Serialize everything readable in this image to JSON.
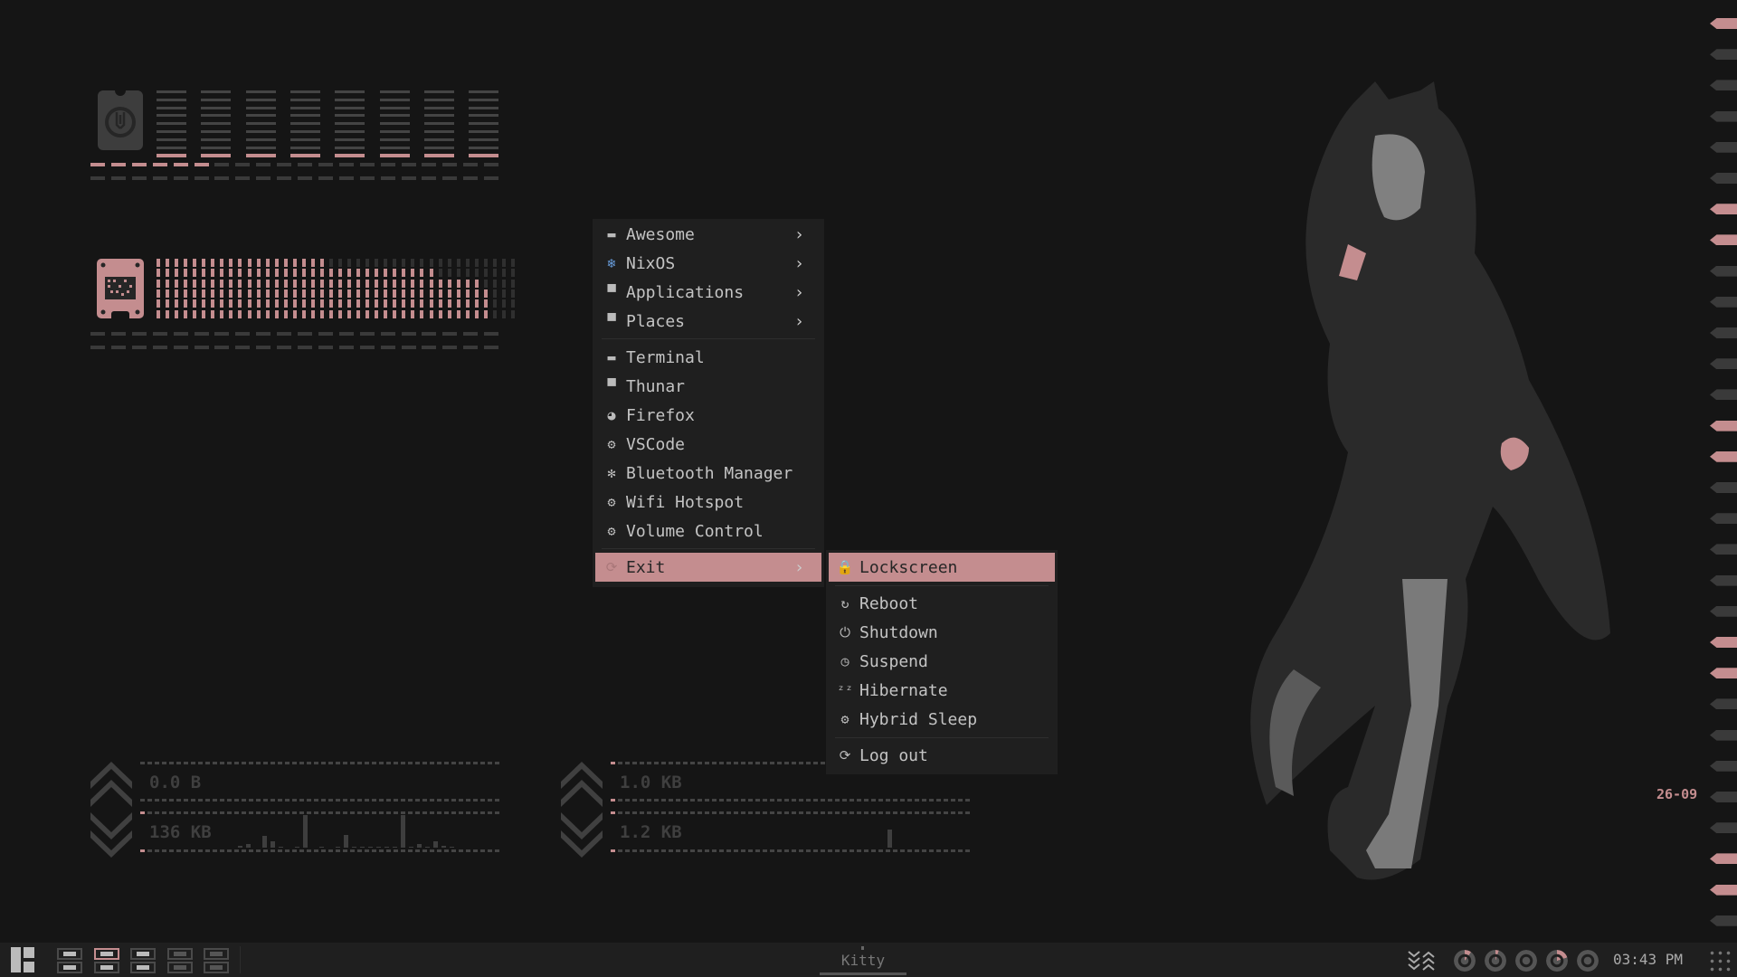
{
  "menu": {
    "items": [
      {
        "label": "Awesome",
        "icon": "awesome-icon",
        "submenu": true
      },
      {
        "label": "NixOS",
        "icon": "nixos-snowflake-icon",
        "submenu": true
      },
      {
        "label": "Applications",
        "icon": "folder-icon",
        "submenu": true
      },
      {
        "label": "Places",
        "icon": "folder-home-icon",
        "submenu": true
      },
      {
        "label": "Terminal",
        "icon": "terminal-icon"
      },
      {
        "label": "Thunar",
        "icon": "folder-icon"
      },
      {
        "label": "Firefox",
        "icon": "firefox-icon"
      },
      {
        "label": "VSCode",
        "icon": "gear-icon"
      },
      {
        "label": "Bluetooth Manager",
        "icon": "bluetooth-icon"
      },
      {
        "label": "Wifi Hotspot",
        "icon": "gear-icon"
      },
      {
        "label": "Volume Control",
        "icon": "gear-icon"
      },
      {
        "label": "Exit",
        "icon": "logout-icon",
        "submenu": true,
        "selected": true
      }
    ]
  },
  "exit_submenu": {
    "items": [
      {
        "label": "Lockscreen",
        "icon": "lock-icon",
        "selected": true
      },
      {
        "label": "Reboot",
        "icon": "reboot-icon"
      },
      {
        "label": "Shutdown",
        "icon": "power-icon"
      },
      {
        "label": "Suspend",
        "icon": "clock-icon"
      },
      {
        "label": "Hibernate",
        "icon": "sleep-zzz-icon"
      },
      {
        "label": "Hybrid Sleep",
        "icon": "gear-icon"
      },
      {
        "label": "Log out",
        "icon": "logout-icon"
      }
    ]
  },
  "cpu_widget": {
    "icon": "cpu-icon",
    "core_count": 8,
    "usage_segments_active": 6,
    "usage_segments_total": 20
  },
  "ram_widget": {
    "icon": "ram-icon",
    "bar_columns": 40,
    "bar_levels": [
      6,
      6,
      6,
      6,
      6,
      6,
      6,
      6,
      6,
      6,
      6,
      6,
      6,
      6,
      6,
      6,
      6,
      6,
      6,
      5,
      5,
      5,
      5,
      5,
      5,
      5,
      5,
      5,
      5,
      5,
      5,
      4,
      4,
      4,
      4,
      4,
      3,
      0,
      0,
      0
    ]
  },
  "network_widgets": [
    {
      "upload": "0.0  B",
      "download": "136 KB",
      "download_history": [
        0.05,
        0.1,
        0,
        0.35,
        0.2,
        0.02,
        0,
        0.04,
        1,
        0,
        0.02,
        0,
        0.03,
        0.4,
        0.02,
        0.02,
        0.02,
        0.03,
        0.02,
        0.02,
        1,
        0.04,
        0.12,
        0.02,
        0.2,
        0.05,
        0.02
      ]
    },
    {
      "upload": "1.0 KB",
      "download": "1.2 KB",
      "download_history": [
        0,
        0,
        0,
        0,
        0,
        0,
        0,
        0,
        0,
        0,
        0,
        0,
        0,
        0,
        0,
        0,
        0,
        0,
        0,
        0,
        0,
        0,
        0.55,
        0,
        0,
        0,
        0
      ]
    }
  ],
  "date_label": "26-09",
  "taskbar": {
    "active_tag": 2,
    "window_title": "Kitty",
    "clock": "03:43 PM"
  },
  "colors": {
    "accent": "#c48d8f",
    "background": "#151515",
    "panel": "#1f1f1f"
  }
}
